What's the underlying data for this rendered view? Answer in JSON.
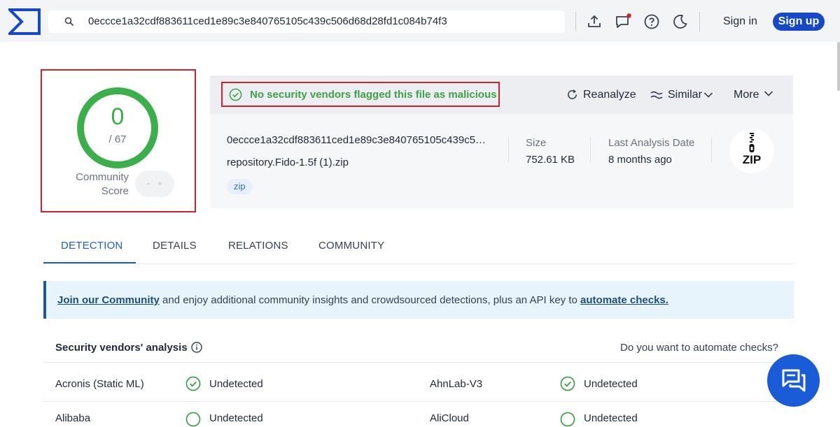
{
  "header": {
    "search_value": "0eccce1a32cdf883611ced1e89c3e840765105c439c506d68d28fd1c084b74f3",
    "signin_label": "Sign in",
    "signup_label": "Sign up",
    "notification_dot_color": "#d3202f"
  },
  "score": {
    "detections": "0",
    "total": "/ 67",
    "community_label_line1": "Community",
    "community_label_line2": "Score",
    "ring_color": "#3bb04a"
  },
  "summary": {
    "verdict": "No security vendors flagged this file as malicious",
    "actions": {
      "reanalyze": "Reanalyze",
      "similar": "Similar",
      "more": "More"
    },
    "hash_truncated": "0eccce1a32cdf883611ced1e89c3e840765105c439c5…",
    "file_name": "repository.Fido-1.5f (1).zip",
    "tag": "zip",
    "size_label": "Size",
    "size_value": "752.61 KB",
    "date_label": "Last Analysis Date",
    "date_value": "8 months ago",
    "file_type_badge": "ZIP"
  },
  "tabs": [
    {
      "label": "DETECTION",
      "active": true
    },
    {
      "label": "DETAILS",
      "active": false
    },
    {
      "label": "RELATIONS",
      "active": false
    },
    {
      "label": "COMMUNITY",
      "active": false
    }
  ],
  "banner": {
    "link1": "Join our Community",
    "middle": " and enjoy additional community insights and crowdsourced detections, plus an API key to ",
    "link2": "automate checks."
  },
  "vendors": {
    "title": "Security vendors' analysis",
    "automate_question": "Do you want to automate checks?",
    "rows": [
      {
        "left": {
          "name": "Acronis (Static ML)",
          "result": "Undetected"
        },
        "right": {
          "name": "AhnLab-V3",
          "result": "Undetected"
        }
      },
      {
        "left": {
          "name": "Alibaba",
          "result": "Undetected"
        },
        "right": {
          "name": "AliCloud",
          "result": "Undetected"
        }
      }
    ]
  },
  "colors": {
    "accent_blue": "#1549c8",
    "clean_green": "#3bb04a",
    "highlight_red": "#d3202f"
  }
}
